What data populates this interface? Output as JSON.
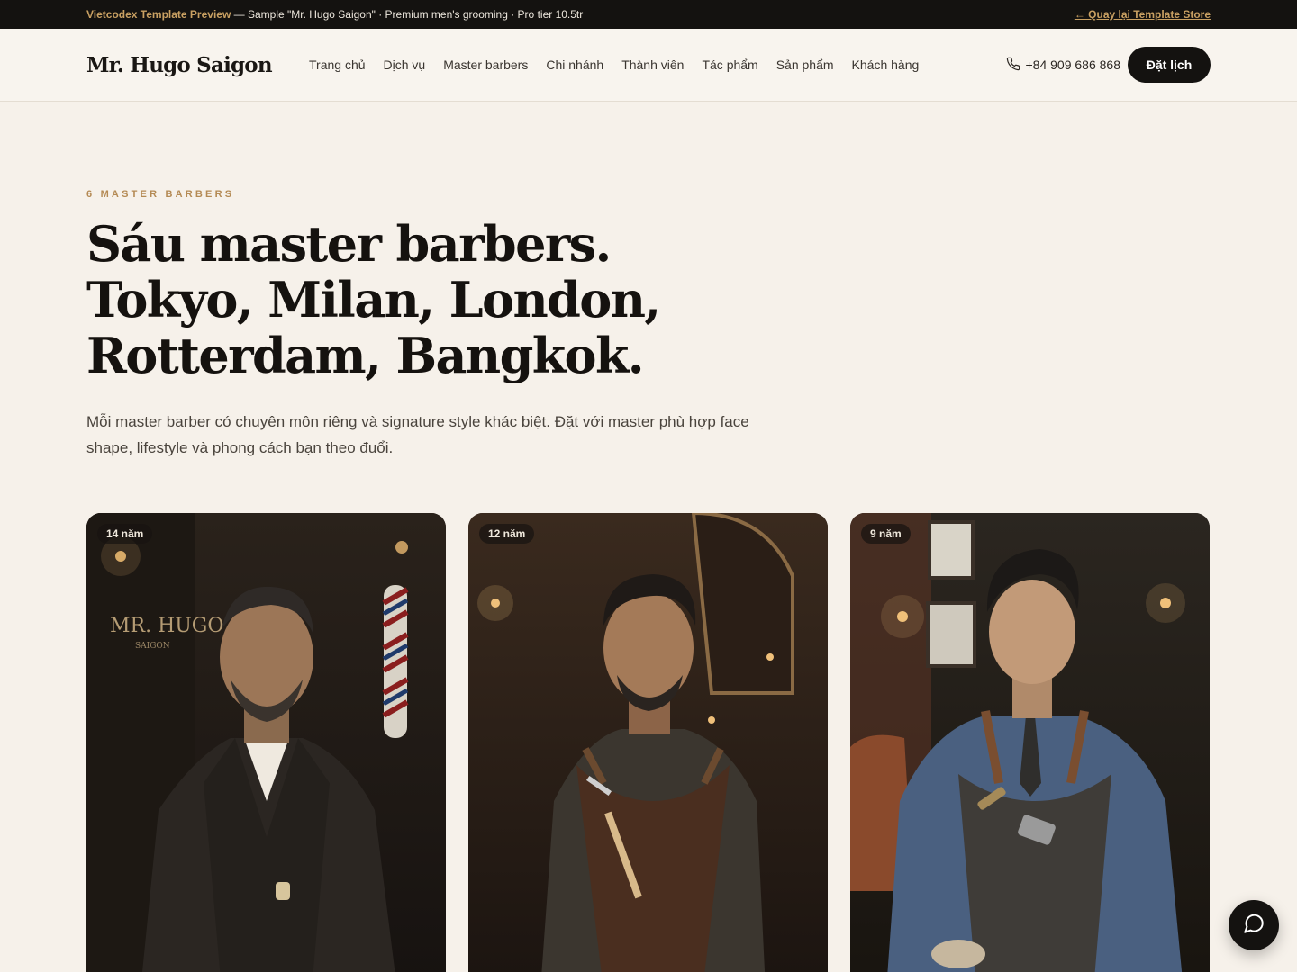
{
  "topbar": {
    "brand": "Vietcodex Template Preview",
    "info": " — Sample \"Mr. Hugo Saigon\" · Premium men's grooming · Pro tier 10.5tr",
    "back_link": "← Quay lại Template Store"
  },
  "header": {
    "logo": "Mr. Hugo Saigon",
    "nav": [
      "Trang chủ",
      "Dịch vụ",
      "Master barbers",
      "Chi nhánh",
      "Thành viên",
      "Tác phẩm",
      "Sản phẩm",
      "Khách hàng"
    ],
    "phone": "+84 909 686 868",
    "cta": "Đặt lịch"
  },
  "hero": {
    "eyebrow": "6 MASTER BARBERS",
    "headline": [
      "Sáu master barbers.",
      "Tokyo, Milan, London,",
      "Rotterdam, Bangkok."
    ],
    "lede": "Mỗi master barber có chuyên môn riêng và signature style khác biệt. Đặt với master phù hợp face shape, lifestyle và phong cách bạn theo đuổi."
  },
  "barbers": [
    {
      "badge": "14 năm",
      "sign": "MR. HUGO",
      "sign_sub": "SAIGON"
    },
    {
      "badge": "12 năm"
    },
    {
      "badge": "9 năm"
    }
  ],
  "icons": {
    "phone": "phone-icon",
    "chat": "chat-bubble-icon"
  },
  "colors": {
    "accent": "#c9a062",
    "dark": "#141210",
    "background": "#f6f1ea"
  }
}
